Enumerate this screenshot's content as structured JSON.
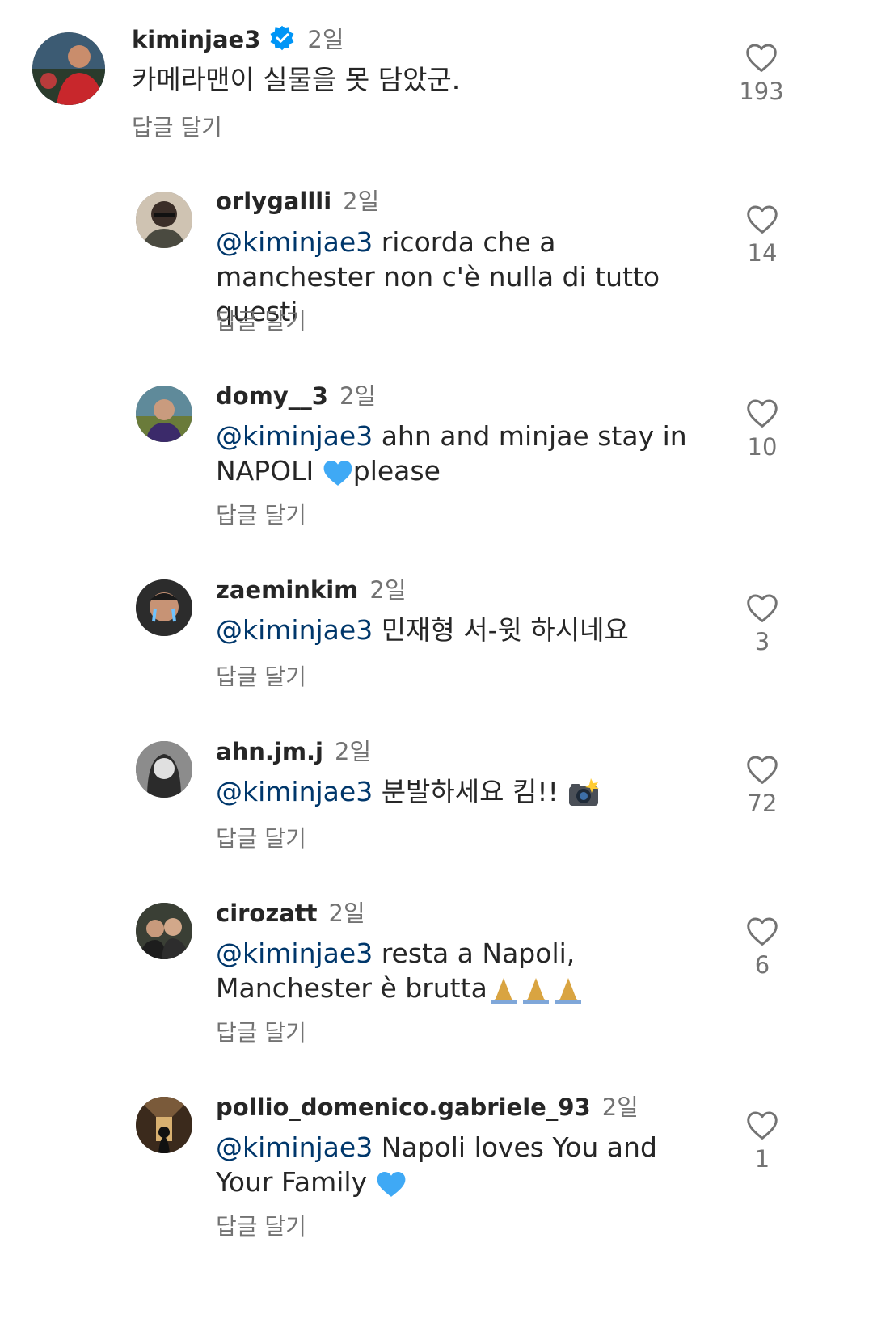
{
  "reply_label": "답글 달기",
  "colors": {
    "mention": "#00376b",
    "meta": "#737373",
    "verified": "#0095f6",
    "text": "#262626"
  },
  "comments": [
    {
      "username": "kiminjae3",
      "verified": true,
      "time": "2일",
      "mention": "",
      "text": "카메라맨이 실물을 못 담았군.",
      "likes": "193",
      "avatar_icon": "profile-photo-red-jersey"
    },
    {
      "username": "orlygallli",
      "time": "2일",
      "mention": "@kiminjae3",
      "text": " ricorda che a manchester non c'è nulla di tutto questi",
      "likes": "14",
      "avatar_icon": "profile-photo-helmet"
    },
    {
      "username": "domy__3",
      "time": "2일",
      "mention": "@kiminjae3",
      "text": " ahn and minjae stay in NAPOLI ",
      "text_after_emoji": "please",
      "emoji": "blue-heart",
      "likes": "10",
      "avatar_icon": "profile-photo-landscape"
    },
    {
      "username": "zaeminkim",
      "time": "2일",
      "mention": "@kiminjae3",
      "text": " 민재형 서-윗 하시네요",
      "likes": "3",
      "avatar_icon": "profile-photo-crying"
    },
    {
      "username": "ahn.jm.j",
      "time": "2일",
      "mention": "@kiminjae3",
      "text": " 분발하세요 킴!! ",
      "emoji": "camera-flash",
      "likes": "72",
      "avatar_icon": "profile-photo-bw"
    },
    {
      "username": "cirozatt",
      "time": "2일",
      "mention": "@kiminjae3",
      "text": " resta a Napoli, Manchester è brutta",
      "emoji": "folded-hands-x3",
      "likes": "6",
      "avatar_icon": "profile-photo-couple"
    },
    {
      "username": "pollio_domenico.gabriele_93",
      "time": "2일",
      "mention": "@kiminjae3",
      "text": " Napoli loves You and Your Family ",
      "emoji": "blue-heart",
      "likes": "1",
      "avatar_icon": "profile-photo-hallway"
    }
  ]
}
